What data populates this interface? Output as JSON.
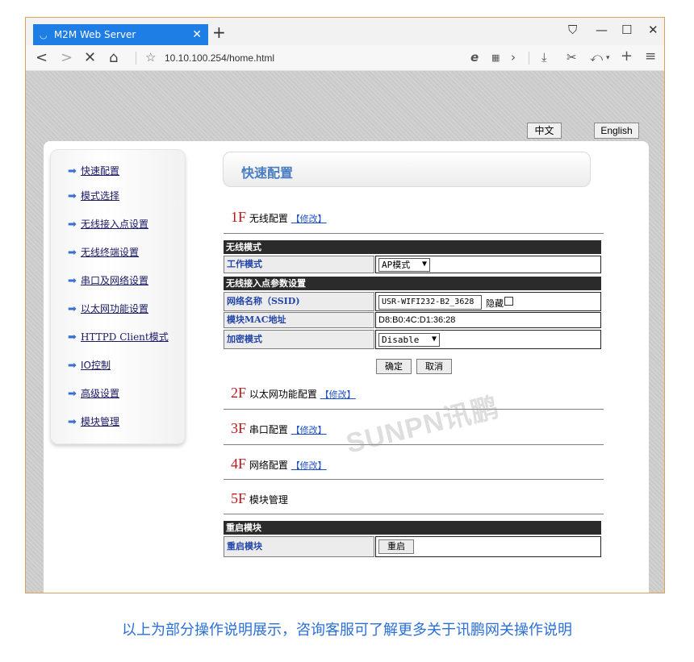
{
  "browser": {
    "tab_title": "M2M Web Server",
    "url": "10.10.100.254/home.html"
  },
  "page": {
    "lang_cn": "中文",
    "lang_en": "English",
    "title": "快速配置",
    "sidebar": [
      "快速配置",
      "模式选择",
      "无线接入点设置",
      "无线终端设置",
      "串口及网络设置",
      "以太网功能设置",
      "HTTPD Client模式",
      "IO控制",
      "高级设置",
      "模块管理"
    ],
    "sections": {
      "s1": {
        "num": "1F",
        "label": "无线配置",
        "edit": "【修改】"
      },
      "s2": {
        "num": "2F",
        "label": "以太网功能配置",
        "edit": "【修改】"
      },
      "s3": {
        "num": "3F",
        "label": "串口配置",
        "edit": "【修改】"
      },
      "s4": {
        "num": "4F",
        "label": "网络配置",
        "edit": "【修改】"
      },
      "s5": {
        "num": "5F",
        "label": "模块管理"
      }
    },
    "wireless": {
      "head_mode": "无线模式",
      "work_mode_label": "工作模式",
      "work_mode_value": "AP模式",
      "head_ap": "无线接入点参数设置",
      "ssid_label": "网络名称（SSID)",
      "ssid_value": "USR-WIFI232-B2_3628",
      "hide_label": "隐藏",
      "mac_label": "模块MAC地址",
      "mac_value": "D8:B0:4C:D1:36:28",
      "enc_label": "加密模式",
      "enc_value": "Disable",
      "ok": "确定",
      "cancel": "取消"
    },
    "restart": {
      "head": "重启模块",
      "label": "重启模块",
      "button": "重启"
    }
  },
  "watermark": "SUNPN讯鹏",
  "caption": "以上为部分操作说明展示，咨询客服可了解更多关于讯鹏网关操作说明"
}
